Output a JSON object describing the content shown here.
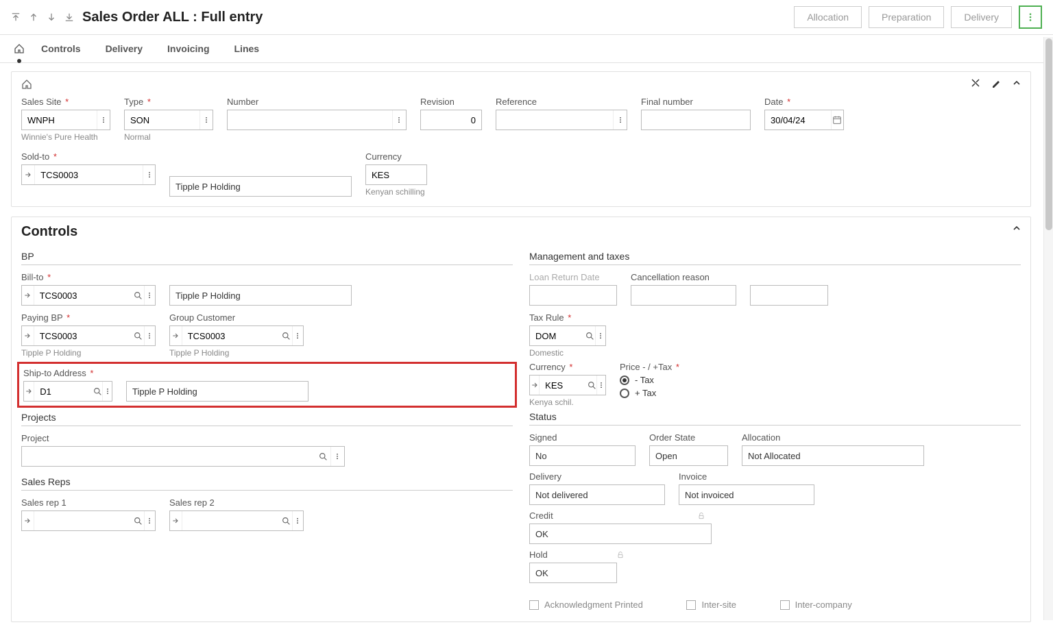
{
  "header": {
    "title": "Sales Order ALL : Full entry",
    "actions": {
      "allocation": "Allocation",
      "preparation": "Preparation",
      "delivery": "Delivery"
    }
  },
  "tabs": {
    "controls": "Controls",
    "delivery": "Delivery",
    "invoicing": "Invoicing",
    "lines": "Lines"
  },
  "top": {
    "salesSite": {
      "label": "Sales Site",
      "value": "WNPH",
      "helper": "Winnie's Pure Health"
    },
    "type": {
      "label": "Type",
      "value": "SON",
      "helper": "Normal"
    },
    "number": {
      "label": "Number",
      "value": ""
    },
    "revision": {
      "label": "Revision",
      "value": "0"
    },
    "reference": {
      "label": "Reference",
      "value": ""
    },
    "finalNumber": {
      "label": "Final number",
      "value": ""
    },
    "date": {
      "label": "Date",
      "value": "30/04/24"
    },
    "soldTo": {
      "label": "Sold-to",
      "value": "TCS0003",
      "name": "Tipple P Holding"
    },
    "currency": {
      "label": "Currency",
      "value": "KES",
      "helper": "Kenyan schilling"
    }
  },
  "controls": {
    "title": "Controls",
    "bp": {
      "heading": "BP",
      "billTo": {
        "label": "Bill-to",
        "value": "TCS0003",
        "name": "Tipple P Holding"
      },
      "payingBp": {
        "label": "Paying BP",
        "value": "TCS0003",
        "helper": "Tipple P Holding"
      },
      "groupCustomer": {
        "label": "Group Customer",
        "value": "TCS0003",
        "helper": "Tipple P Holding"
      },
      "shipTo": {
        "label": "Ship-to Address",
        "value": "D1",
        "name": "Tipple P Holding"
      }
    },
    "projects": {
      "heading": "Projects",
      "project": {
        "label": "Project",
        "value": ""
      }
    },
    "salesReps": {
      "heading": "Sales Reps",
      "rep1": {
        "label": "Sales rep 1",
        "value": ""
      },
      "rep2": {
        "label": "Sales rep 2",
        "value": ""
      }
    },
    "mgmt": {
      "heading": "Management and taxes",
      "loanReturn": {
        "label": "Loan Return Date",
        "value": ""
      },
      "cancelReason": {
        "label": "Cancellation reason",
        "value": ""
      },
      "taxRule": {
        "label": "Tax Rule",
        "value": "DOM",
        "helper": "Domestic"
      },
      "currency": {
        "label": "Currency",
        "value": "KES",
        "helper": "Kenya schil."
      },
      "priceTax": {
        "label": "Price - / +Tax",
        "opt1": "- Tax",
        "opt2": "+ Tax"
      }
    },
    "status": {
      "heading": "Status",
      "signed": {
        "label": "Signed",
        "value": "No"
      },
      "orderState": {
        "label": "Order State",
        "value": "Open"
      },
      "allocation": {
        "label": "Allocation",
        "value": "Not Allocated"
      },
      "delivery": {
        "label": "Delivery",
        "value": "Not delivered"
      },
      "invoice": {
        "label": "Invoice",
        "value": "Not invoiced"
      },
      "credit": {
        "label": "Credit",
        "value": "OK"
      },
      "hold": {
        "label": "Hold",
        "value": "OK"
      }
    },
    "footer": {
      "ack": "Acknowledgment Printed",
      "inter": "Inter-site",
      "intercompany": "Inter-company"
    }
  }
}
